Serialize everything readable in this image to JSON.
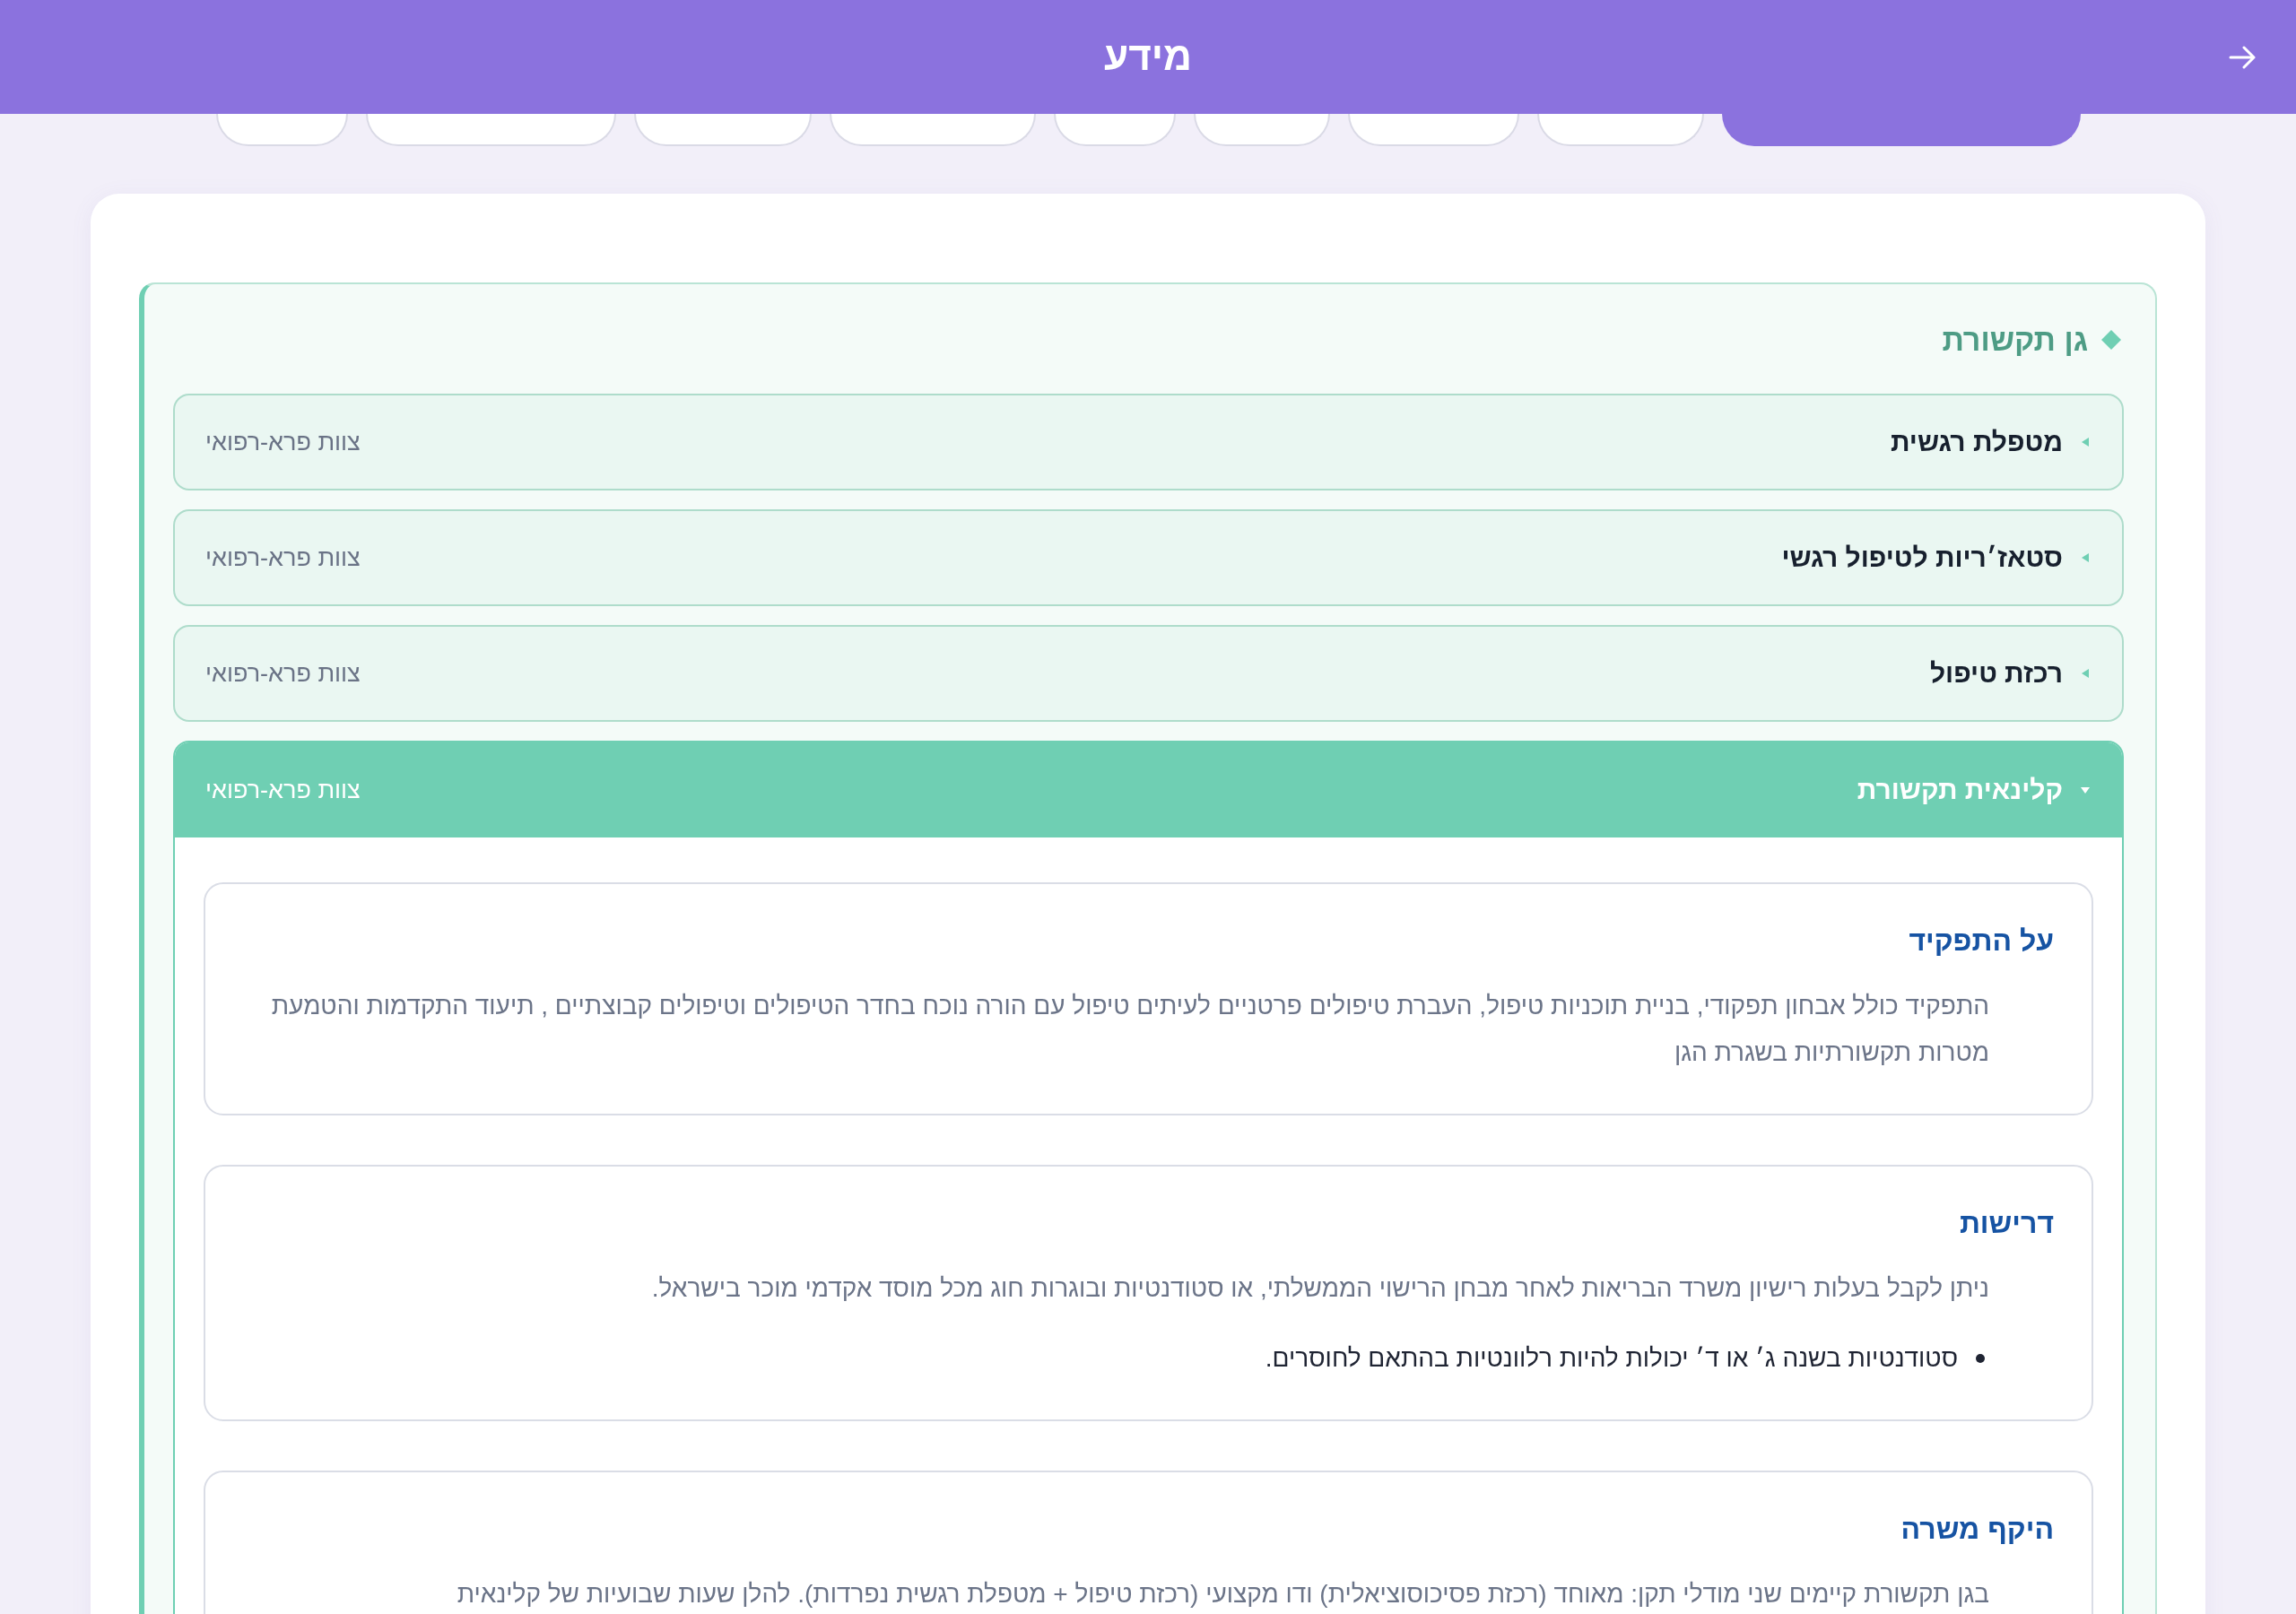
{
  "header": {
    "title": "מידע"
  },
  "tabs": [
    {
      "selected": true
    },
    {
      "selected": false
    },
    {
      "selected": false
    },
    {
      "selected": false
    },
    {
      "selected": false
    },
    {
      "selected": false
    },
    {
      "selected": false
    },
    {
      "selected": false
    },
    {
      "selected": false
    }
  ],
  "section": {
    "title": "גן תקשורת",
    "roles": [
      {
        "title": "מטפלת רגשית",
        "team": "צוות פרא-רפואי",
        "expanded": false
      },
      {
        "title": "סטאז׳ריות לטיפול רגשי",
        "team": "צוות פרא-רפואי",
        "expanded": false
      },
      {
        "title": "רכזת טיפול",
        "team": "צוות פרא-רפואי",
        "expanded": false
      },
      {
        "title": "קלינאית תקשורת",
        "team": "צוות פרא-רפואי",
        "expanded": true,
        "blocks": [
          {
            "title": "על התפקיד",
            "paragraphs": [
              "התפקיד כולל אבחון תפקודי, בניית תוכניות טיפול, העברת טיפולים פרטניים לעיתים טיפול עם הורה נוכח בחדר הטיפולים וטיפולים קבוצתיים , תיעוד התקדמות והטמעת מטרות תקשורתיות בשגרת הגן"
            ]
          },
          {
            "title": "דרישות",
            "paragraphs": [
              "ניתן לקבל בעלות רישיון משרד הבריאות לאחר מבחן הרישוי הממשלתי, או סטודנטיות ובוגרות חוג מכל מוסד אקדמי מוכר בישראל."
            ],
            "bullets": [
              "סטודנטיות בשנה ג׳ או ד׳ יכולות להיות רלוונטיות בהתאם לחוסרים."
            ]
          },
          {
            "title": "היקף משרה",
            "paragraphs": [
              "בגן תקשורת קיימים שני מודלי תקן: מאוחד (רכזת פסיכוסוציאלית) ודו מקצועי (רכזת טיפול + מטפלת רגשית נפרדות). להלן שעות שבועיות של קלינאית"
            ]
          }
        ]
      }
    ]
  }
}
